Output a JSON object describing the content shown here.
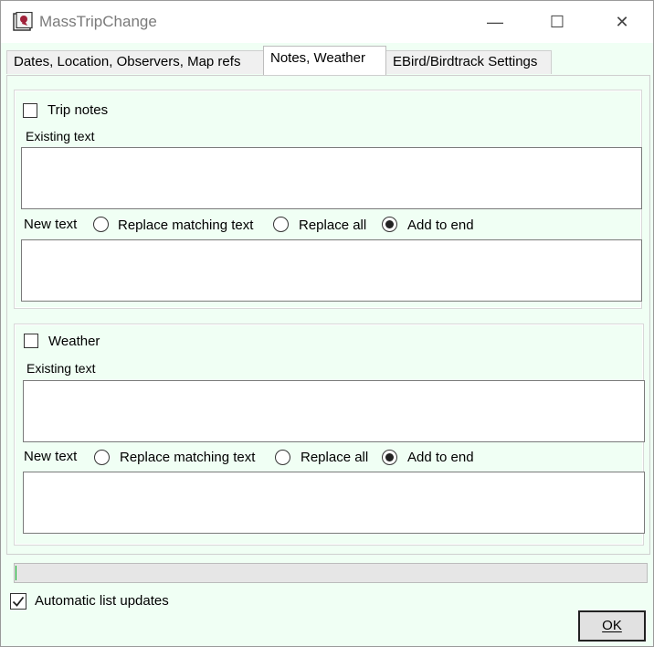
{
  "window": {
    "title": "MassTripChange",
    "minimize_label": "—",
    "maximize_label": "☐",
    "close_label": "✕"
  },
  "tabs": [
    {
      "label": "Dates, Location, Observers, Map refs"
    },
    {
      "label": "Notes, Weather"
    },
    {
      "label": "EBird/Birdtrack Settings"
    }
  ],
  "trip_notes": {
    "label": "Trip  notes",
    "checked": false,
    "existing_label": "Existing text",
    "existing_value": "",
    "new_label": "New text",
    "new_value": "",
    "options": [
      "Replace matching text",
      "Replace all",
      "Add to end"
    ],
    "selected": "Add to end"
  },
  "weather": {
    "label": "Weather",
    "checked": false,
    "existing_label": "Existing text",
    "existing_value": "",
    "new_label": "New text",
    "new_value": "",
    "options": [
      "Replace matching text",
      "Replace all",
      "Add to end"
    ],
    "selected": "Add to end"
  },
  "progress": {
    "value": 0.0
  },
  "auto_update": {
    "label": "Automatic list updates",
    "checked": true
  },
  "ok_button": {
    "label": "OK"
  },
  "colors": {
    "pane": "#f0fff4",
    "progress_fill": "#06b025"
  }
}
